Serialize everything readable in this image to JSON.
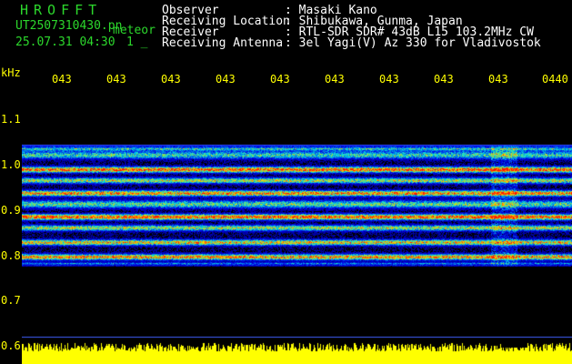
{
  "header": {
    "brand": "HROFFT",
    "filename": "UT2507310430.pn",
    "mode": "meteor",
    "datetime": "25.07.31 04:30",
    "count": "1 _",
    "info": [
      {
        "label": "Observer",
        "value": ": Masaki Kano"
      },
      {
        "label": "Receiving Location",
        "value": ": Shibukawa, Gunma, Japan"
      },
      {
        "label": "Receiver",
        "value": ": RTL-SDR SDR# 43dB L15 103.2MHz CW"
      },
      {
        "label": "Receiving Antenna",
        "value": ": 3el Yagi(V) Az 330 for Vladivostok"
      }
    ]
  },
  "axis": {
    "unit": "kHz",
    "y_labels": [
      "1.1",
      "1.0",
      "0.9",
      "0.8",
      "0.7",
      "0.6"
    ],
    "x_labels": [
      "043",
      "043",
      "043",
      "043",
      "043",
      "043",
      "043",
      "043",
      "043",
      "0440"
    ]
  },
  "colors": {
    "background": "#000000",
    "text": "#ffffff",
    "brand": "#2cd82c",
    "axis": "#ffff00",
    "signal_low": "#1030a0",
    "signal_high": "#ff2020"
  }
}
